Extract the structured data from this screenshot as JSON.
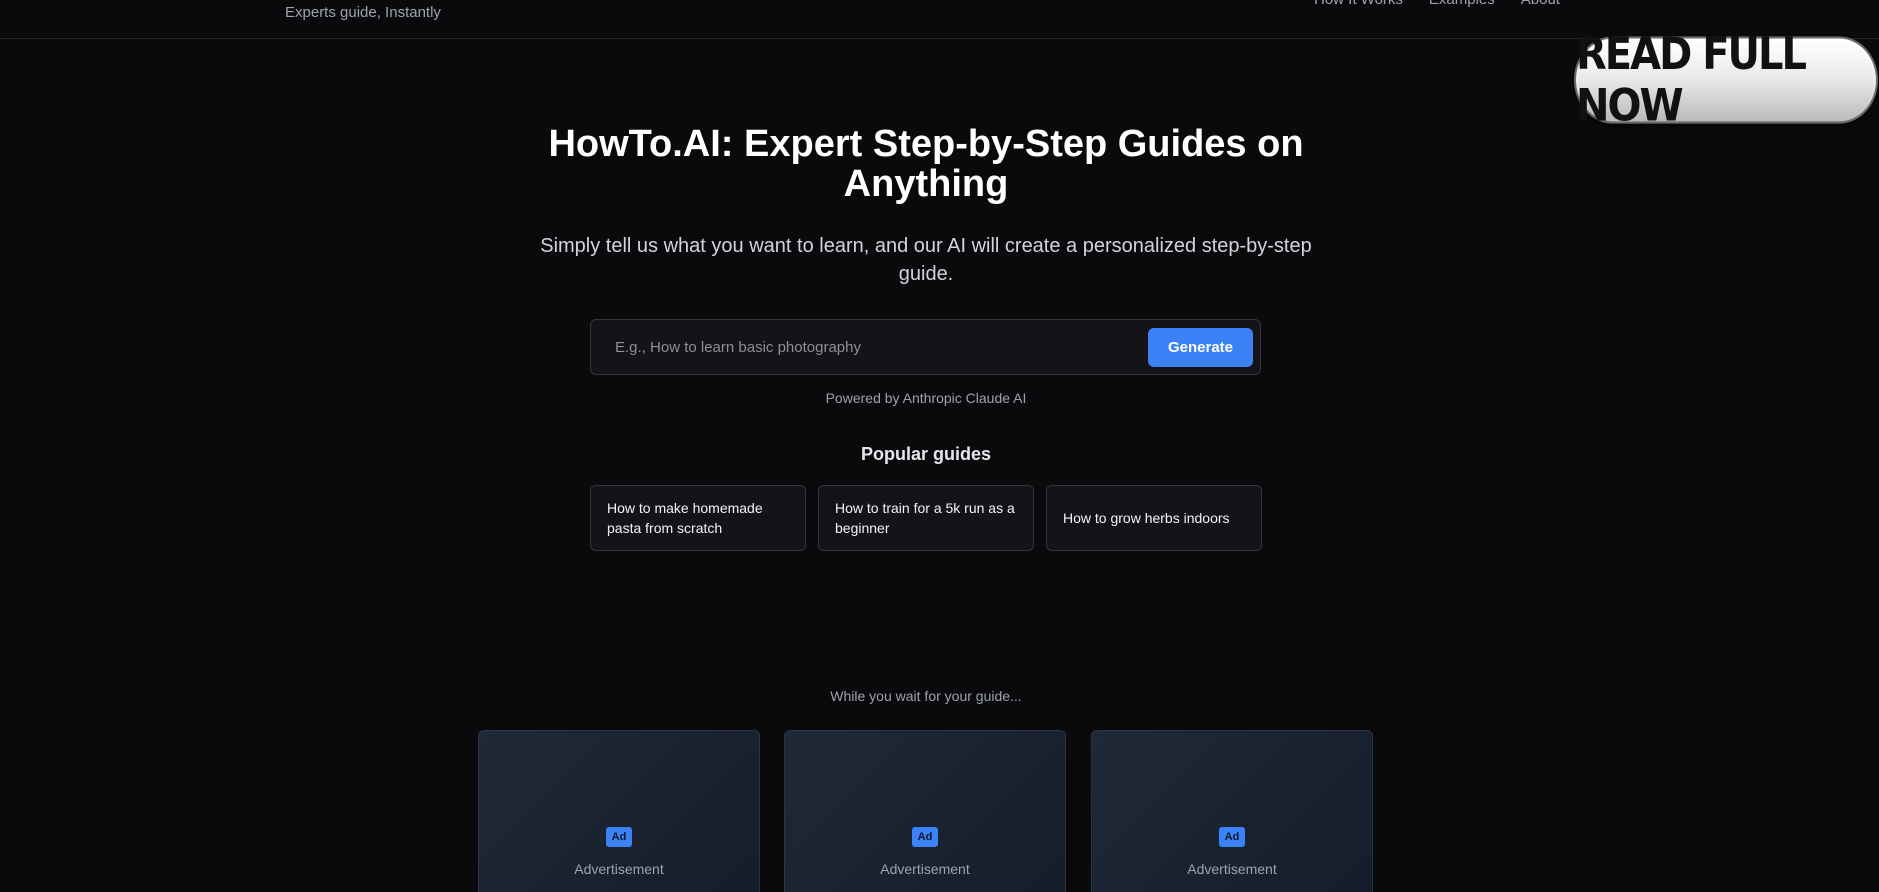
{
  "header": {
    "tagline": "Experts guide, Instantly",
    "nav": [
      "How It Works",
      "Examples",
      "About"
    ]
  },
  "floating_button": {
    "label": "READ FULL NOW"
  },
  "hero": {
    "title": "HowTo.AI: Expert Step-by-Step Guides on Anything",
    "subtitle": "Simply tell us what you want to learn, and our AI will create a personalized step-by-step guide."
  },
  "search": {
    "placeholder": "E.g., How to learn basic photography",
    "value": "",
    "button_label": "Generate",
    "powered_by": "Powered by Anthropic Claude AI"
  },
  "popular": {
    "title": "Popular guides",
    "items": [
      "How to make homemade pasta from scratch",
      "How to train for a 5k run as a beginner",
      "How to grow herbs indoors"
    ]
  },
  "ads": {
    "intro": "While you wait for your guide...",
    "badge": "Ad",
    "label": "Advertisement",
    "count": 3
  },
  "colors": {
    "background": "#0a0a0c",
    "accent": "#3b82f6"
  }
}
